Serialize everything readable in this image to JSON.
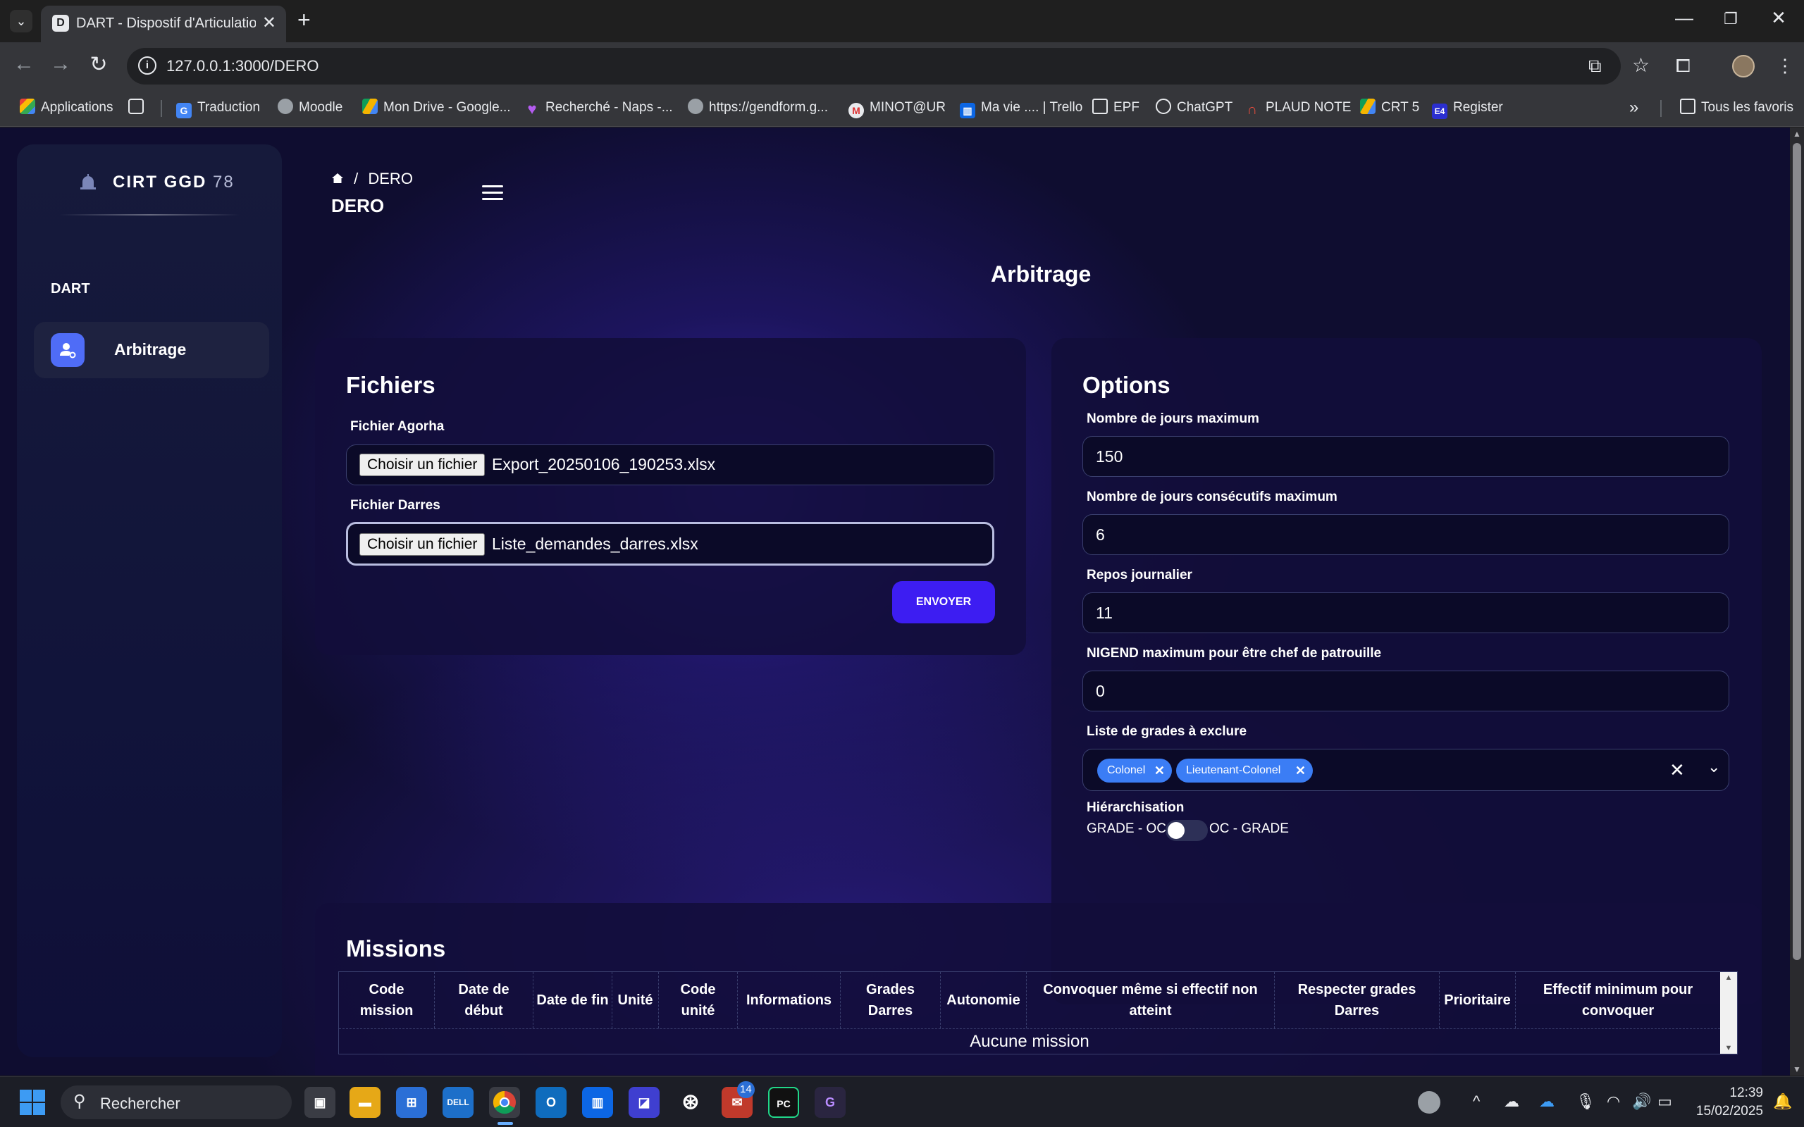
{
  "browser": {
    "tab_title": "DART - Dispostif d'Articulation d",
    "tab_favicon": "D",
    "url": "127.0.0.1:3000/DERO",
    "bookmarks": [
      {
        "label": "Applications",
        "icon": "apps-grid-icon"
      },
      {
        "label": "Traduction",
        "icon": "translate-icon"
      },
      {
        "label": "Moodle",
        "icon": "globe-icon"
      },
      {
        "label": "Mon Drive - Google...",
        "icon": "google-drive-icon"
      },
      {
        "label": "Recherché - Naps -...",
        "icon": "heart-icon"
      },
      {
        "label": "https://gendform.g...",
        "icon": "globe-icon"
      },
      {
        "label": "MINOT@UR",
        "icon": "minotaur-icon"
      },
      {
        "label": "Ma vie .... | Trello",
        "icon": "trello-icon"
      },
      {
        "label": "EPF",
        "icon": "folder-icon"
      },
      {
        "label": "ChatGPT",
        "icon": "chatgpt-icon"
      },
      {
        "label": "PLAUD NOTE",
        "icon": "plaud-icon"
      },
      {
        "label": "CRT 5",
        "icon": "google-drive-icon"
      },
      {
        "label": "Register",
        "icon": "e4-icon"
      }
    ],
    "all_bookmarks_label": "Tous les favoris"
  },
  "sidebar": {
    "brand": "CIRT GGD",
    "brand_number": "78",
    "section": "DART",
    "items": [
      {
        "label": "Arbitrage",
        "active": true
      }
    ]
  },
  "header": {
    "breadcrumb_current": "DERO",
    "page_heading": "DERO"
  },
  "main": {
    "title": "Arbitrage",
    "files_card": {
      "title": "Fichiers",
      "agorha_label": "Fichier Agorha",
      "agorha_button": "Choisir un fichier",
      "agorha_file": "Export_20250106_190253.xlsx",
      "darres_label": "Fichier Darres",
      "darres_button": "Choisir un fichier",
      "darres_file": "Liste_demandes_darres.xlsx",
      "submit_label": "ENVOYER"
    },
    "options_card": {
      "title": "Options",
      "max_days_label": "Nombre de jours maximum",
      "max_days_value": "150",
      "max_consecutive_label": "Nombre de jours consécutifs maximum",
      "max_consecutive_value": "6",
      "daily_rest_label": "Repos journalier",
      "daily_rest_value": "11",
      "nigend_label": "NIGEND maximum pour être chef de patrouille",
      "nigend_value": "0",
      "excluded_grades_label": "Liste de grades à exclure",
      "excluded_grades": [
        "Colonel",
        "Lieutenant-Colonel"
      ],
      "hierarchy_label": "Hiérarchisation",
      "hierarchy_left": "GRADE - OC",
      "hierarchy_right": "OC - GRADE",
      "hierarchy_toggle_on": false
    },
    "missions_card": {
      "title": "Missions",
      "columns": [
        "Code mission",
        "Date de début",
        "Date de fin",
        "Unité",
        "Code unité",
        "Informations",
        "Grades Darres",
        "Autonomie",
        "Convoquer même si effectif non atteint",
        "Respecter grades Darres",
        "Prioritaire",
        "Effectif minimum pour convoquer"
      ],
      "empty_text": "Aucune mission"
    }
  },
  "taskbar": {
    "search_placeholder": "Rechercher",
    "badge_count": "14",
    "time": "12:39",
    "date": "15/02/2025"
  },
  "colors": {
    "accent": "#3d1df2",
    "chip": "#3b7df5",
    "sidebar_icon": "#4f6cf7",
    "page_bg": "#0f0d30"
  }
}
